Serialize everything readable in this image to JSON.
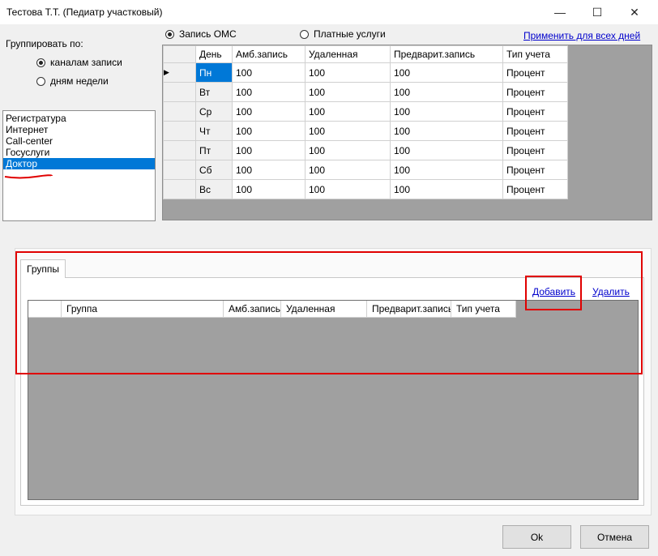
{
  "window": {
    "title": "Тестова Т.Т. (Педиатр участковый)",
    "minimize": "—",
    "maximize": "☐",
    "close": "✕"
  },
  "grouping": {
    "label": "Группировать по:",
    "options": [
      {
        "label": "каналам записи",
        "checked": true
      },
      {
        "label": "дням недели",
        "checked": false
      }
    ]
  },
  "channels": {
    "items": [
      "Регистратура",
      "Интернет",
      "Call-center",
      "Госуслуги",
      "Доктор"
    ],
    "selected": "Доктор"
  },
  "service_type": {
    "options": [
      {
        "label": "Запись ОМС",
        "checked": true
      },
      {
        "label": "Платные услуги",
        "checked": false
      }
    ],
    "apply_all_link": "Применить для всех дней"
  },
  "schedule_grid": {
    "columns": [
      "День",
      "Амб.запись",
      "Удаленная",
      "Предварит.запись",
      "Тип учета"
    ],
    "rows": [
      {
        "day": "Пн",
        "amb": "100",
        "remote": "100",
        "pre": "100",
        "type": "Процент"
      },
      {
        "day": "Вт",
        "amb": "100",
        "remote": "100",
        "pre": "100",
        "type": "Процент"
      },
      {
        "day": "Ср",
        "amb": "100",
        "remote": "100",
        "pre": "100",
        "type": "Процент"
      },
      {
        "day": "Чт",
        "amb": "100",
        "remote": "100",
        "pre": "100",
        "type": "Процент"
      },
      {
        "day": "Пт",
        "amb": "100",
        "remote": "100",
        "pre": "100",
        "type": "Процент"
      },
      {
        "day": "Сб",
        "amb": "100",
        "remote": "100",
        "pre": "100",
        "type": "Процент"
      },
      {
        "day": "Вс",
        "amb": "100",
        "remote": "100",
        "pre": "100",
        "type": "Процент"
      }
    ],
    "current_row_marker": "▶"
  },
  "groups_tab": {
    "tab_label": "Группы",
    "add_link": "Добавить",
    "delete_link": "Удалить",
    "columns": [
      "Группа",
      "Амб.запись",
      "Удаленная",
      "Предварит.запись",
      "Тип учета"
    ]
  },
  "buttons": {
    "ok": "Ok",
    "cancel": "Отмена"
  },
  "colors": {
    "selection": "#0078d7",
    "highlight": "#e00000",
    "link": "#0000cc"
  }
}
